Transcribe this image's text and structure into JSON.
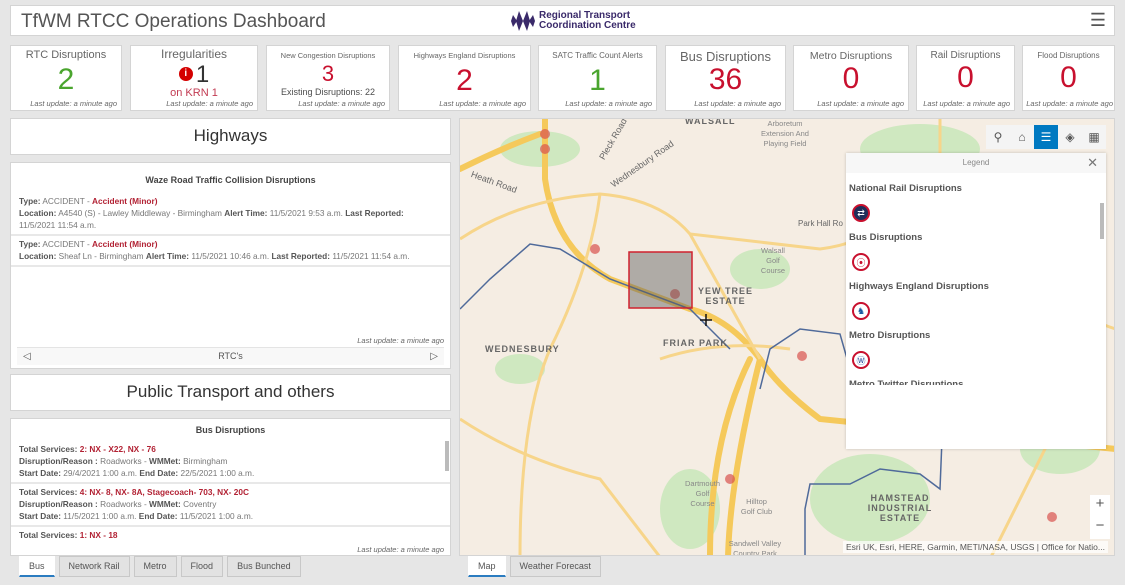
{
  "header": {
    "title": "TfWM RTCC Operations Dashboard",
    "logo_text_1": "Regional Transport",
    "logo_text_2": "Coordination Centre"
  },
  "cards": [
    {
      "label": "RTC Disruptions",
      "value": "2",
      "update": "Last update: a minute ago"
    },
    {
      "label": "Irregularities",
      "value": "1",
      "sub": "on KRN 1",
      "update": "Last update: a minute ago"
    },
    {
      "label": "New Congestion Disruptions",
      "value": "3",
      "sub": "Existing Disruptions: 22",
      "update": "Last update: a minute ago"
    },
    {
      "label": "Highways England Disruptions",
      "value": "2",
      "update": "Last update: a minute ago"
    },
    {
      "label": "SATC Traffic Count Alerts",
      "value": "1",
      "update": "Last update: a minute ago"
    },
    {
      "label": "Bus Disruptions",
      "value": "36",
      "update": "Last update: a minute ago"
    },
    {
      "label": "Metro Disruptions",
      "value": "0",
      "update": "Last update: a minute ago"
    },
    {
      "label": "Rail Disruptions",
      "value": "0",
      "update": "Last update: a minute ago"
    },
    {
      "label": "Flood Disruptions",
      "value": "0",
      "update": "Last update: a minute ago"
    }
  ],
  "colors": {
    "green": "#4aa52e",
    "red": "#c8102e",
    "accent": "#0079c1"
  },
  "highways": {
    "title": "Highways",
    "list_title": "Waze Road Traffic Collision Disruptions",
    "update": "Last update: a minute ago",
    "nav_label": "RTC's",
    "items": [
      {
        "type": "ACCIDENT",
        "subtype": "Accident (Minor)",
        "location": "A4540 (S) - Lawley Middleway - Birmingham",
        "alert_time": "11/5/2021 9:53 a.m.",
        "last_reported": "11/5/2021 11:54 a.m."
      },
      {
        "type": "ACCIDENT",
        "subtype": "Accident (Minor)",
        "location": "Sheaf Ln - Birmingham",
        "alert_time": "11/5/2021 10:46 a.m.",
        "last_reported": "11/5/2021 11:54 a.m."
      }
    ]
  },
  "labels": {
    "type": "Type:",
    "location": "Location:",
    "alert_time": "Alert Time:",
    "last_reported": "Last Reported:",
    "total_services": "Total Services:",
    "reason": "Disruption/Reason :",
    "wmmet": "WMMet:",
    "start": "Start Date:",
    "end": "End Date:"
  },
  "public": {
    "title": "Public Transport and others",
    "list_title": "Bus Disruptions",
    "update": "Last update: a minute ago",
    "items": [
      {
        "services": "2: NX - X22, NX - 76",
        "reason": "Roadworks",
        "wmmet": "Birmingham",
        "start": "29/4/2021 1:00 a.m.",
        "end": "22/5/2021 1:00 a.m."
      },
      {
        "services": "4: NX- 8, NX- 8A, Stagecoach- 703, NX- 20C",
        "reason": "Roadworks",
        "wmmet": "Coventry",
        "start": "11/5/2021 1:00 a.m.",
        "end": "11/5/2021 1:00 a.m."
      },
      {
        "services": "1: NX - 18"
      }
    ],
    "tabs": [
      "Bus",
      "Network Rail",
      "Metro",
      "Flood",
      "Bus Bunched"
    ]
  },
  "map": {
    "tabs": [
      "Map",
      "Weather Forecast"
    ],
    "attribution": "Esri UK, Esri, HERE, Garmin, METI/NASA, USGS | Office for Natio...",
    "places": [
      "WALSALL",
      "WEDNESBURY",
      "FRIAR PARK",
      "YEW TREE ESTATE",
      "HAMSTEAD INDUSTRIAL ESTATE",
      "Heath Road",
      "Wednesbury Road",
      "Pleck Road",
      "Park Hall Ro",
      "Walsall Golf Course",
      "Arboretum Extension And Playing Field",
      "Dartmouth Golf Course",
      "Hilltop Golf Club",
      "Sandwell Valley Country Park"
    ],
    "legend": {
      "title": "Legend",
      "items": [
        "National Rail Disruptions",
        "Bus Disruptions",
        "Highways England Disruptions",
        "Metro Disruptions",
        "Metro Twitter Disruptions"
      ]
    }
  }
}
